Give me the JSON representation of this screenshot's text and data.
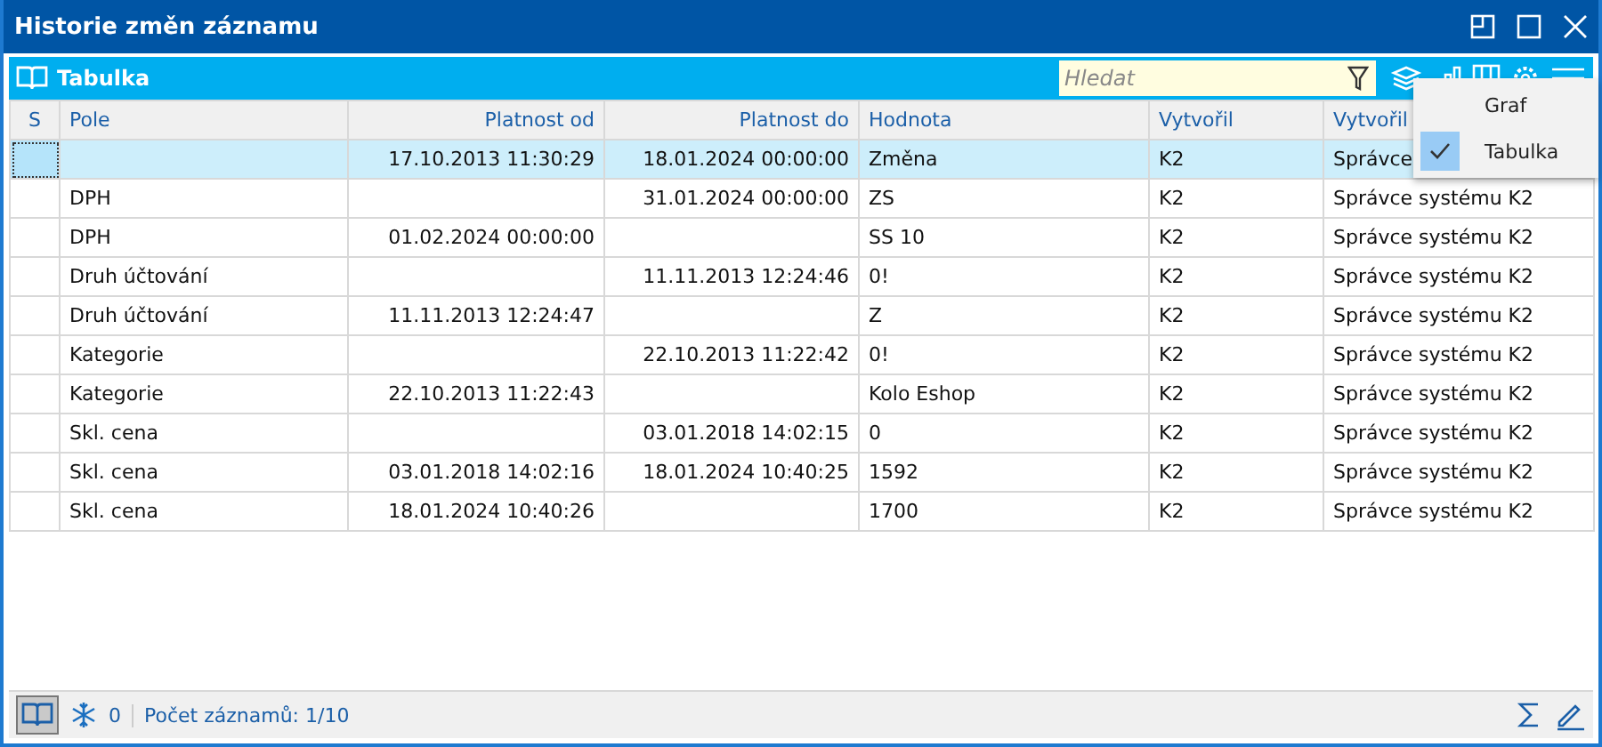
{
  "window": {
    "title": "Historie změn záznamu"
  },
  "toolbar": {
    "title": "Tabulka",
    "search": {
      "placeholder": "Hledat"
    }
  },
  "table": {
    "columns": [
      "S",
      "Pole",
      "Platnost od",
      "Platnost do",
      "Hodnota",
      "Vytvořil",
      "Vytvořil"
    ],
    "rows": [
      {
        "selected": true,
        "cells": [
          "",
          "",
          "17.10.2013 11:30:29",
          "18.01.2024 00:00:00",
          "Změna",
          "K2",
          "Správce"
        ]
      },
      {
        "selected": false,
        "cells": [
          "",
          "DPH",
          "",
          "31.01.2024 00:00:00",
          "ZS",
          "K2",
          "Správce systému K2"
        ]
      },
      {
        "selected": false,
        "cells": [
          "",
          "DPH",
          "01.02.2024 00:00:00",
          "",
          "SS 10",
          "K2",
          "Správce systému K2"
        ]
      },
      {
        "selected": false,
        "cells": [
          "",
          "Druh účtování",
          "",
          "11.11.2013 12:24:46",
          "0!",
          "K2",
          "Správce systému K2"
        ]
      },
      {
        "selected": false,
        "cells": [
          "",
          "Druh účtování",
          "11.11.2013 12:24:47",
          "",
          "Z",
          "K2",
          "Správce systému K2"
        ]
      },
      {
        "selected": false,
        "cells": [
          "",
          "Kategorie",
          "",
          "22.10.2013 11:22:42",
          "0!",
          "K2",
          "Správce systému K2"
        ]
      },
      {
        "selected": false,
        "cells": [
          "",
          "Kategorie",
          "22.10.2013 11:22:43",
          "",
          "Kolo Eshop",
          "K2",
          "Správce systému K2"
        ]
      },
      {
        "selected": false,
        "cells": [
          "",
          "Skl. cena",
          "",
          "03.01.2018 14:02:15",
          "0",
          "K2",
          "Správce systému K2"
        ]
      },
      {
        "selected": false,
        "cells": [
          "",
          "Skl. cena",
          "03.01.2018 14:02:16",
          "18.01.2024 10:40:25",
          "1592",
          "K2",
          "Správce systému K2"
        ]
      },
      {
        "selected": false,
        "cells": [
          "",
          "Skl. cena",
          "18.01.2024 10:40:26",
          "",
          "1700",
          "K2",
          "Správce systému K2"
        ]
      }
    ]
  },
  "menu": {
    "items": [
      {
        "label": "Graf",
        "checked": false
      },
      {
        "label": "Tabulka",
        "checked": true
      }
    ]
  },
  "status_bar": {
    "count": "0",
    "records": "Počet záznamů: 1/10"
  }
}
